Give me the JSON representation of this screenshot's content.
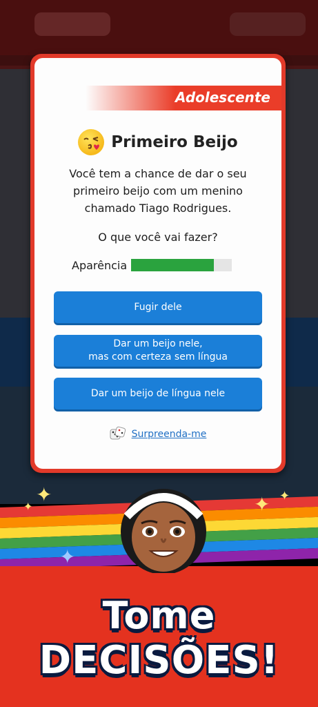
{
  "modal": {
    "stage_label": "Adolescente",
    "title": "Primeiro Beijo",
    "description_lines": [
      "Você tem a chance de dar o seu",
      "primeiro beijo com um menino",
      "chamado Tiago Rodrigues."
    ],
    "question": "O que você vai fazer?",
    "attribute": {
      "label": "Aparência",
      "value": 0.82,
      "color": "#2aa33e"
    },
    "choices": [
      {
        "lines": [
          "Fugir dele"
        ]
      },
      {
        "lines": [
          "Dar um beijo nele,",
          "mas com certeza sem língua"
        ]
      },
      {
        "lines": [
          "Dar um beijo de língua nele"
        ]
      }
    ],
    "surprise_label": "Surpreenda-me",
    "icons": {
      "title_icon": "kiss-emoji-icon",
      "dice_icon": "dice-icon"
    }
  },
  "promo": {
    "line1": "Tome",
    "line2": "DECISÕES!"
  },
  "colors": {
    "accent_red": "#e23a2a",
    "button_blue": "#1b7fd8",
    "link_blue": "#1f6fc4",
    "banner_red": "#e4321f"
  }
}
